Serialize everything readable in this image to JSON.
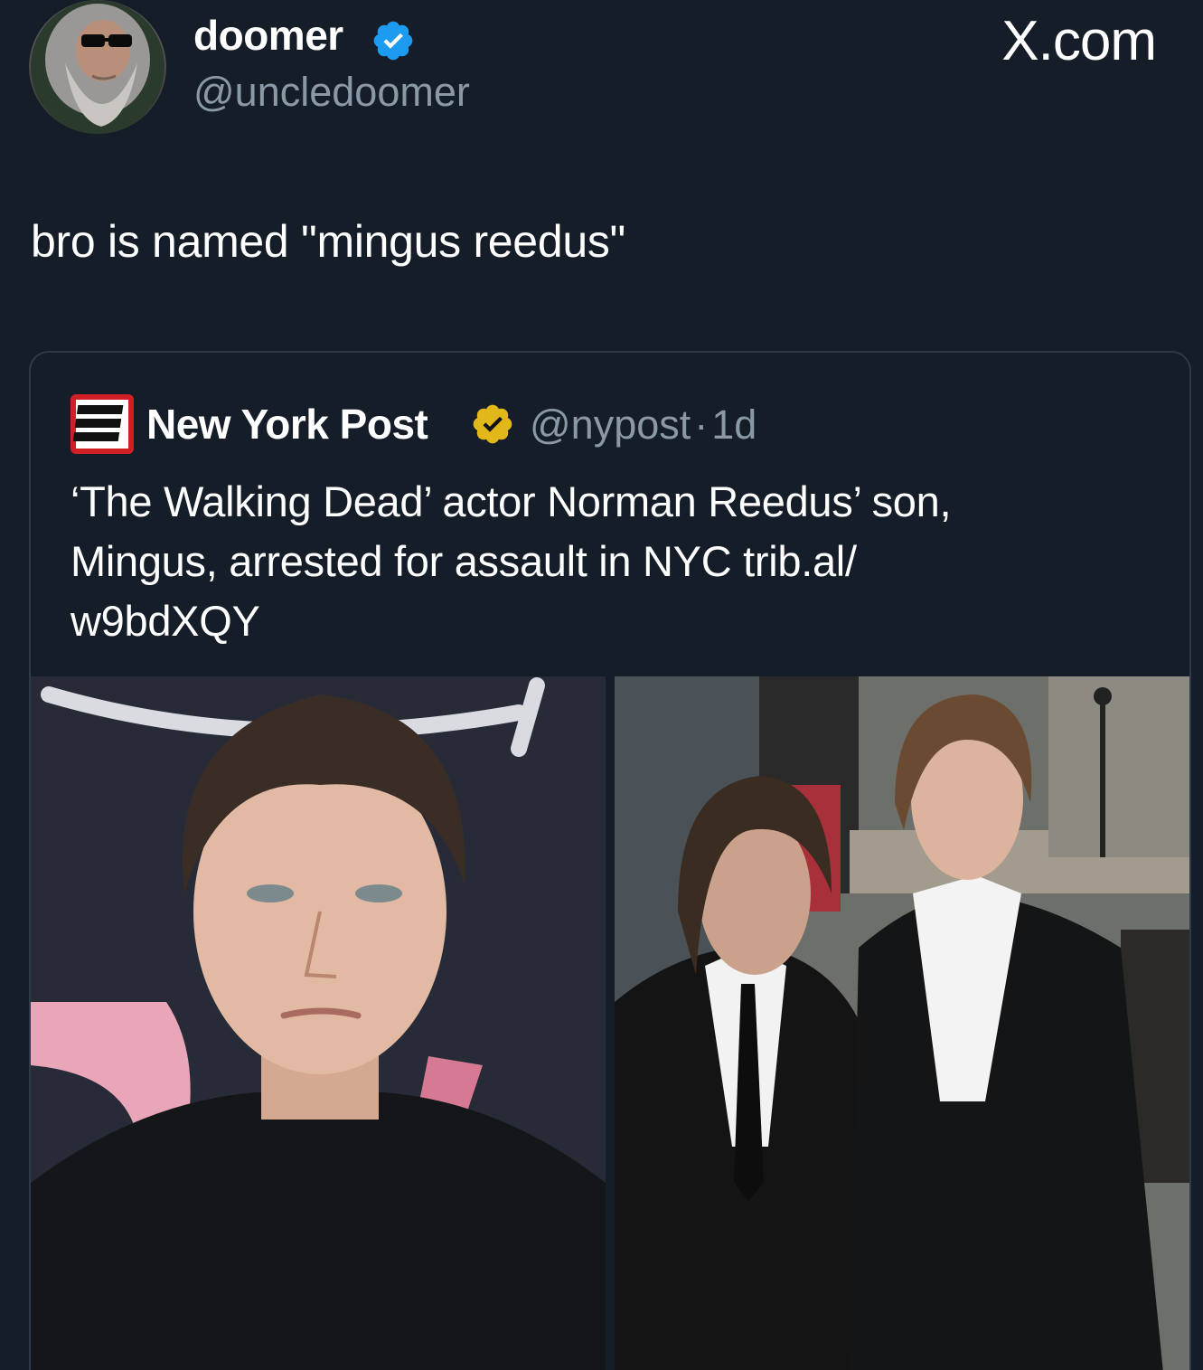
{
  "author": {
    "display_name": "doomer",
    "handle": "@uncledoomer",
    "verified": true,
    "avatar_icon": "avatar-bearded-wizard-sunglasses"
  },
  "site_mark": "X.com",
  "tweet": {
    "text": "bro is named \"mingus reedus\""
  },
  "quoted_tweet": {
    "display_name": "New York Post",
    "handle": "@nypost",
    "separator": "·",
    "age": "1d",
    "verified_org": true,
    "logo_icon": "new-york-post-logo",
    "text_line_1": "‘The Walking Dead’ actor Norman Reedus’ son,",
    "text_line_2": "Mingus, arrested for assault in NYC trib.al/",
    "text_line_3": "w9bdXQY",
    "media": [
      {
        "name": "portrait-photo",
        "description_icon": "photo-icon"
      },
      {
        "name": "father-son-photo",
        "description_icon": "photo-icon"
      }
    ]
  },
  "colors": {
    "background": "#151d29",
    "text": "#ffffff",
    "secondary_text": "#8b98a5",
    "verified_blue": "#1d9bf0",
    "verified_gold": "#e2b719",
    "nyp_red": "#d21f26",
    "card_border": "#2f3a48"
  }
}
